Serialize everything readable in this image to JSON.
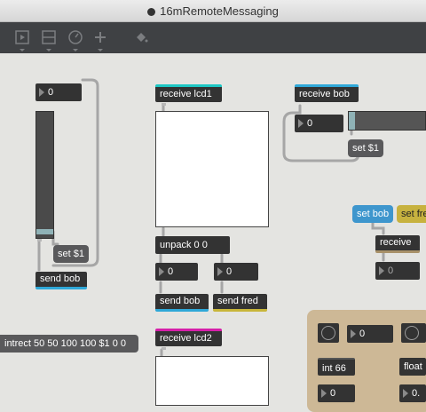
{
  "window": {
    "title": "16mRemoteMessaging"
  },
  "toolbar": {
    "icons": [
      "presentation-icon",
      "patcher-layout-icon",
      "clock-icon",
      "add-icon",
      "paint-bucket-icon"
    ]
  },
  "patch": {
    "slider_num": "0",
    "set_msg_left": "set $1",
    "send_bob_left": "send bob",
    "receive_lcd1": "receive lcd1",
    "unpack": "unpack 0 0",
    "unpack_num1": "0",
    "unpack_num2": "0",
    "send_bob_mid": "send bob",
    "send_fred": "send fred",
    "receive_lcd2": "receive lcd2",
    "paintrect_msg": "intrect 50 50 100 100 $1 0 0",
    "receive_bob": "receive bob",
    "bob_num": "0",
    "set_msg_right": "set $1",
    "set_bob_msg": "set bob",
    "set_fred_msg": "set fre",
    "receive_right": "receive",
    "receive_num": "0",
    "int_num": "0",
    "int_obj": "int 66",
    "int_out": "0",
    "float_obj": "float",
    "float_out": "0."
  },
  "colors": {
    "send_receive_blue": "#2fa8d8",
    "lcd_cyan": "#1dc7c4",
    "lcd_magenta": "#d61fa9",
    "send_yellow": "#c8b63a",
    "panel_tan": "#cdb896"
  }
}
